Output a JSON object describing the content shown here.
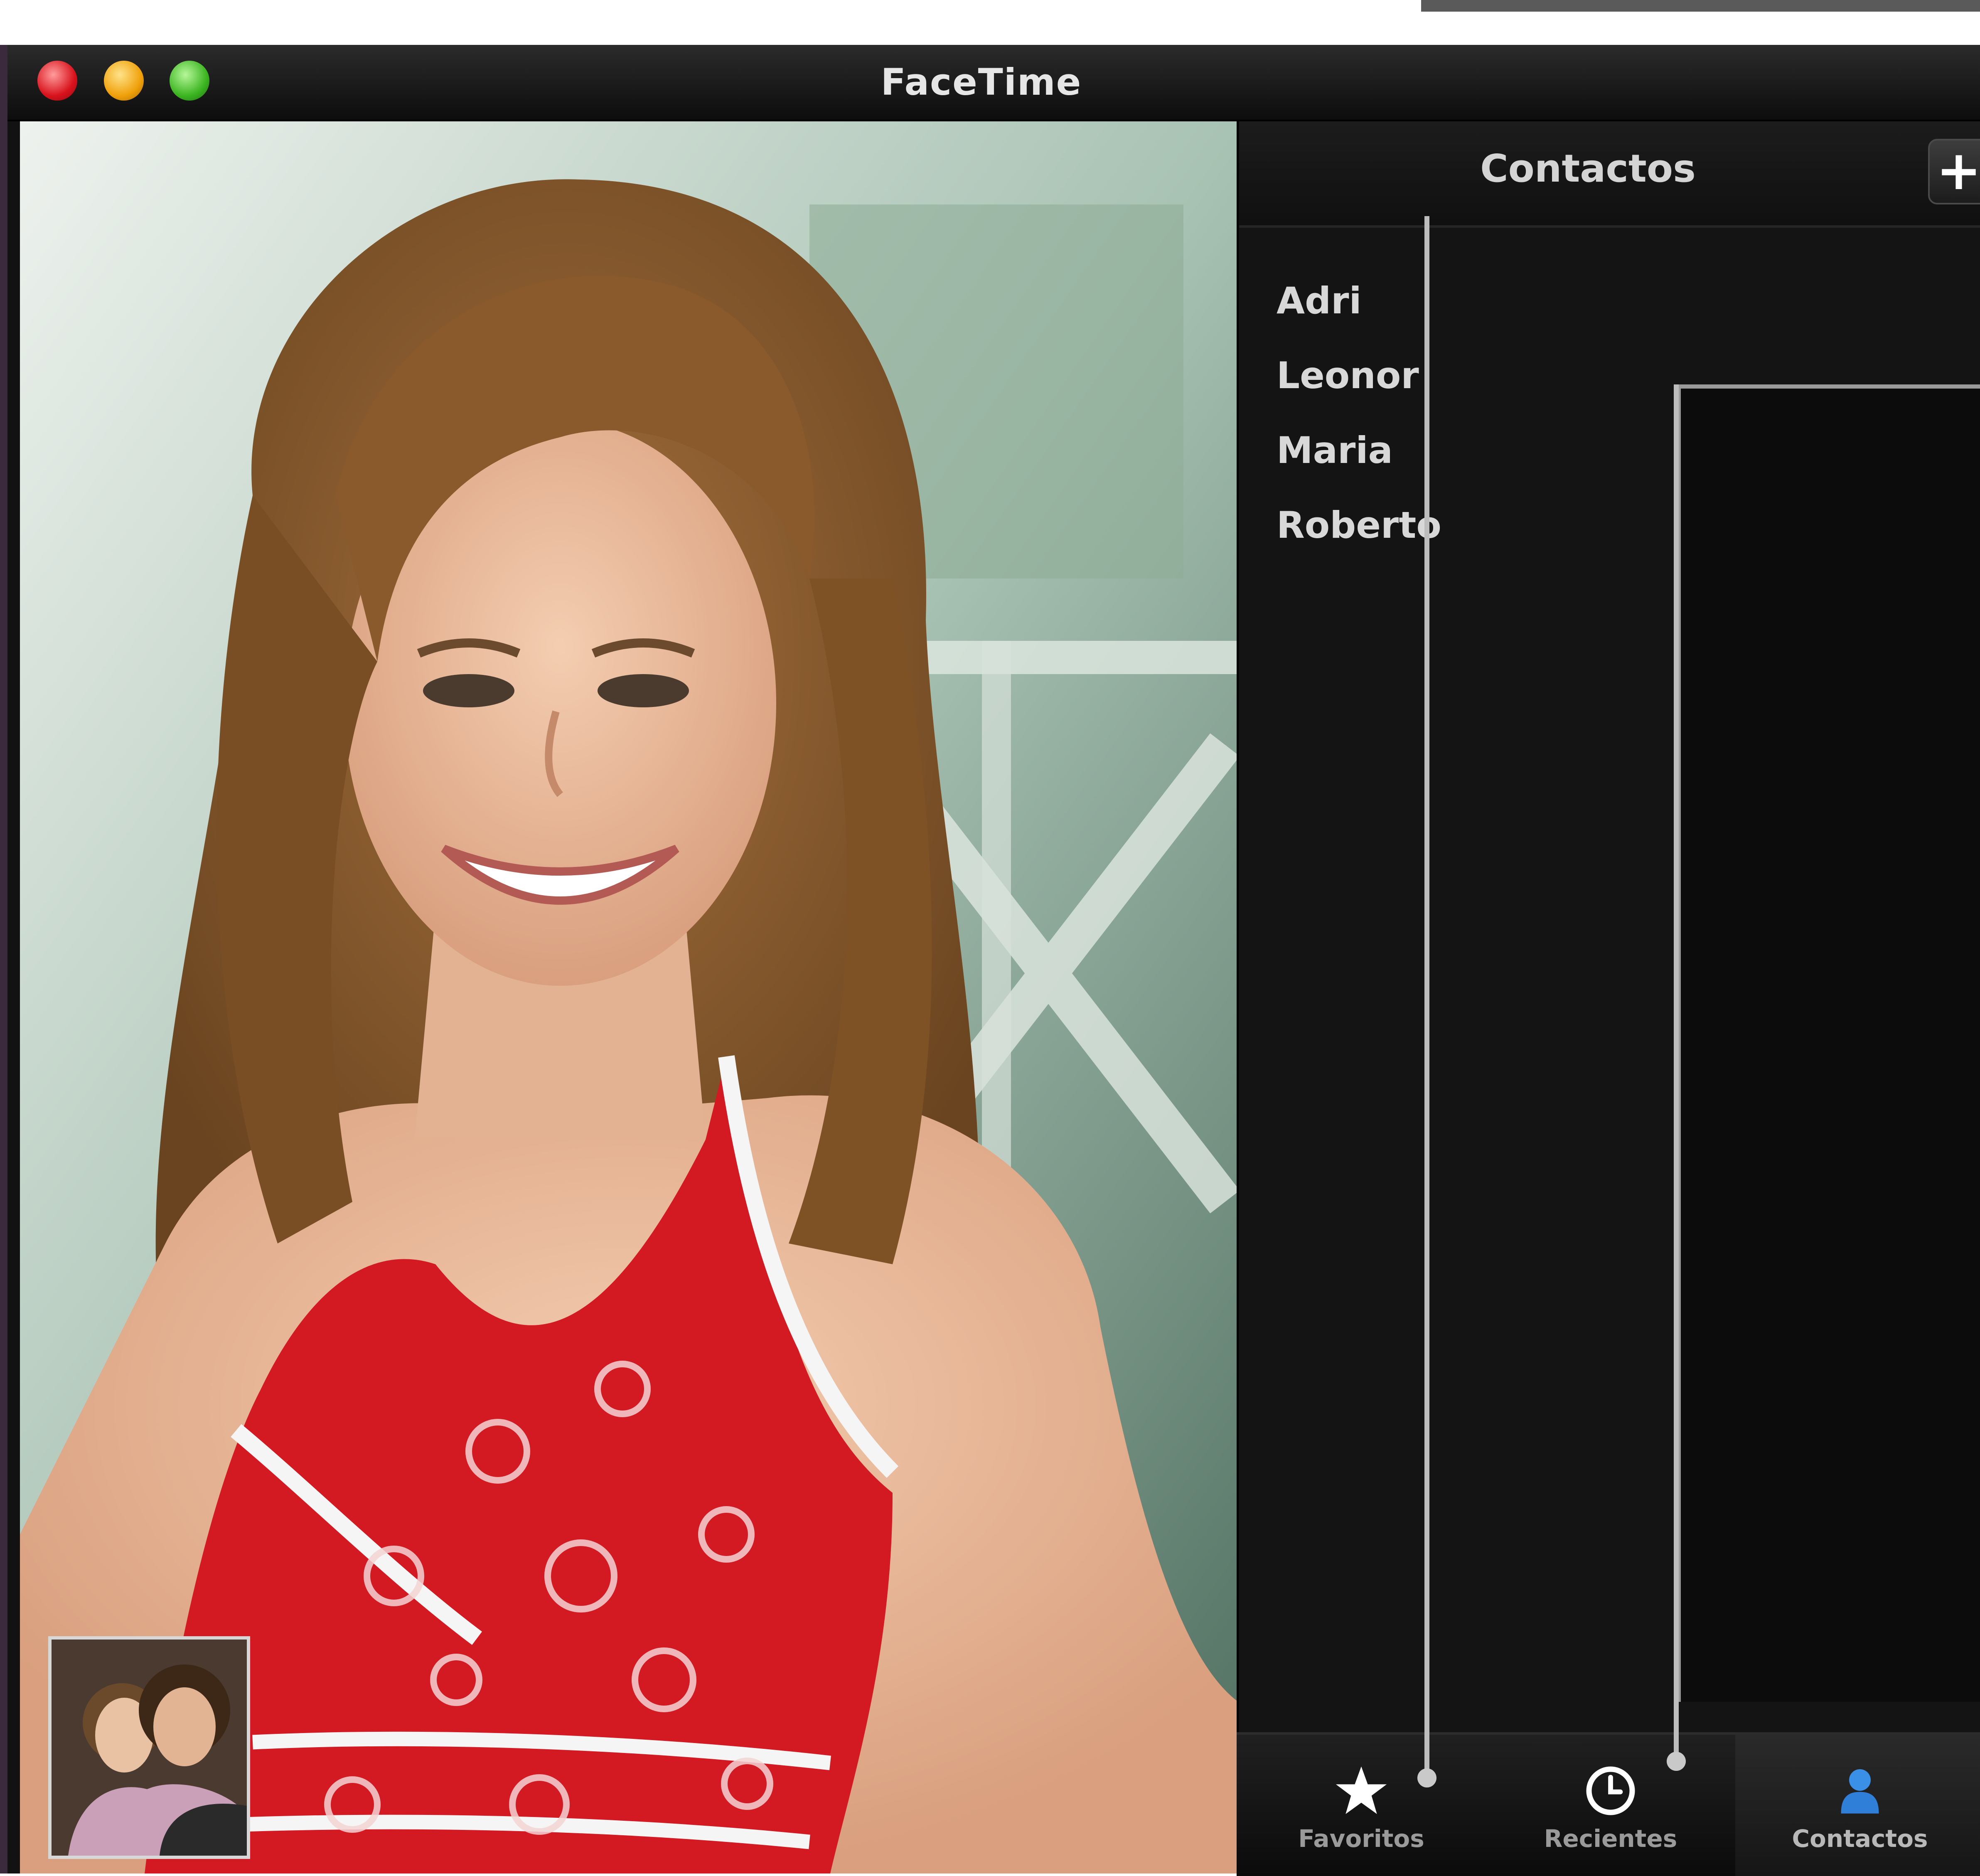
{
  "window": {
    "title": "FaceTime"
  },
  "panel": {
    "title": "Contactos",
    "add_symbol": "+",
    "contacts": [
      "Adri",
      "Leonor",
      "Maria",
      "Roberto"
    ]
  },
  "tabs": [
    {
      "label": "Favoritos",
      "icon": "star-icon"
    },
    {
      "label": "Recientes",
      "icon": "clock-icon"
    },
    {
      "label": "Contactos",
      "icon": "person-icon"
    }
  ]
}
